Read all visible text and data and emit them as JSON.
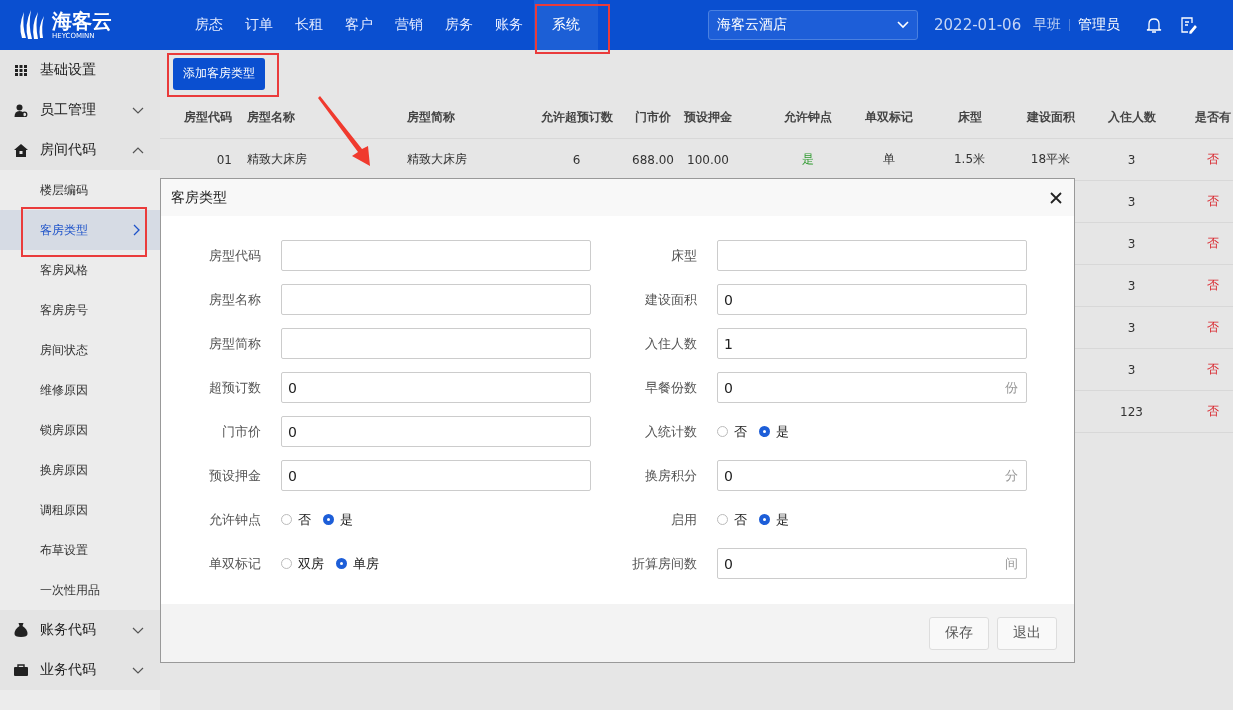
{
  "header": {
    "logo": {
      "name": "海客云",
      "subtitle": "HEYCOMINN"
    },
    "nav": [
      {
        "label": "房态",
        "selected": false
      },
      {
        "label": "订单",
        "selected": false
      },
      {
        "label": "长租",
        "selected": false
      },
      {
        "label": "客户",
        "selected": false
      },
      {
        "label": "营销",
        "selected": false
      },
      {
        "label": "房务",
        "selected": false
      },
      {
        "label": "账务",
        "selected": false
      },
      {
        "label": "系统",
        "selected": true
      }
    ],
    "hotel_select": {
      "value": "海客云酒店"
    },
    "date": "2022-01-06",
    "shift": "早班",
    "user": "管理员"
  },
  "sidebar": {
    "items": [
      {
        "label": "基础设置"
      },
      {
        "label": "员工管理",
        "expanded": false
      },
      {
        "label": "房间代码",
        "expanded": true,
        "children": [
          {
            "label": "楼层编码",
            "selected": false
          },
          {
            "label": "客房类型",
            "selected": true
          },
          {
            "label": "客房风格",
            "selected": false
          },
          {
            "label": "客房房号",
            "selected": false
          },
          {
            "label": "房间状态",
            "selected": false
          },
          {
            "label": "维修原因",
            "selected": false
          },
          {
            "label": "锁房原因",
            "selected": false
          },
          {
            "label": "换房原因",
            "selected": false
          },
          {
            "label": "调租原因",
            "selected": false
          },
          {
            "label": "布草设置",
            "selected": false
          },
          {
            "label": "一次性用品",
            "selected": false
          }
        ]
      },
      {
        "label": "账务代码",
        "expanded": false
      },
      {
        "label": "业务代码",
        "expanded": false
      }
    ]
  },
  "toolbar": {
    "add_button": "添加客房类型"
  },
  "table": {
    "columns": [
      "房型代码",
      "房型名称",
      "房型简称",
      "允许超预订数",
      "门市价",
      "预设押金",
      "允许钟点",
      "单双标记",
      "床型",
      "建设面积",
      "入住人数",
      "是否有"
    ],
    "rows": [
      {
        "cells": [
          "01",
          "精致大床房",
          "精致大床房",
          "6",
          "688.00",
          "100.00",
          {
            "text": "是",
            "on": true
          },
          "单",
          "1.5米",
          "18平米",
          "3",
          {
            "text": "否",
            "on": false
          }
        ]
      },
      {
        "cells": [
          "3",
          {
            "text": "否",
            "on": false
          }
        ]
      },
      {
        "cells": [
          "3",
          {
            "text": "否",
            "on": false
          }
        ]
      },
      {
        "cells": [
          "3",
          {
            "text": "否",
            "on": false
          }
        ]
      },
      {
        "cells": [
          "3",
          {
            "text": "否",
            "on": false
          }
        ]
      },
      {
        "cells": [
          "3",
          {
            "text": "否",
            "on": false
          }
        ]
      },
      {
        "cells": [
          "123",
          {
            "text": "否",
            "on": false
          }
        ]
      }
    ]
  },
  "dialog": {
    "title": "客房类型",
    "fields": [
      {
        "label": "房型代码",
        "kind": "input"
      },
      {
        "label": "床型",
        "kind": "input"
      },
      {
        "label": "房型名称",
        "kind": "input"
      },
      {
        "label": "建设面积",
        "kind": "input",
        "value": "0"
      },
      {
        "label": "房型简称",
        "kind": "input"
      },
      {
        "label": "入住人数",
        "kind": "input",
        "value": "1"
      },
      {
        "label": "超预订数",
        "kind": "input",
        "value": "0"
      },
      {
        "label": "早餐份数",
        "kind": "input",
        "value": "0",
        "unit": "份"
      },
      {
        "label": "门市价",
        "kind": "input",
        "value": "0"
      },
      {
        "label": "入统计数",
        "kind": "radio",
        "options": [
          {
            "label": "否",
            "selected": false
          },
          {
            "label": "是",
            "selected": true
          }
        ]
      },
      {
        "label": "预设押金",
        "kind": "input",
        "value": "0"
      },
      {
        "label": "换房积分",
        "kind": "input",
        "value": "0",
        "unit": "分"
      },
      {
        "label": "允许钟点",
        "kind": "radio",
        "options": [
          {
            "label": "否",
            "selected": false
          },
          {
            "label": "是",
            "selected": true
          }
        ]
      },
      {
        "label": "启用",
        "kind": "radio",
        "options": [
          {
            "label": "否",
            "selected": false
          },
          {
            "label": "是",
            "selected": true
          }
        ]
      },
      {
        "label": "单双标记",
        "kind": "radio",
        "options": [
          {
            "label": "双房",
            "selected": false
          },
          {
            "label": "单房",
            "selected": true
          }
        ]
      },
      {
        "label": "折算房间数",
        "kind": "input",
        "value": "0",
        "unit": "间"
      }
    ],
    "buttons": [
      "保存",
      "退出"
    ]
  }
}
